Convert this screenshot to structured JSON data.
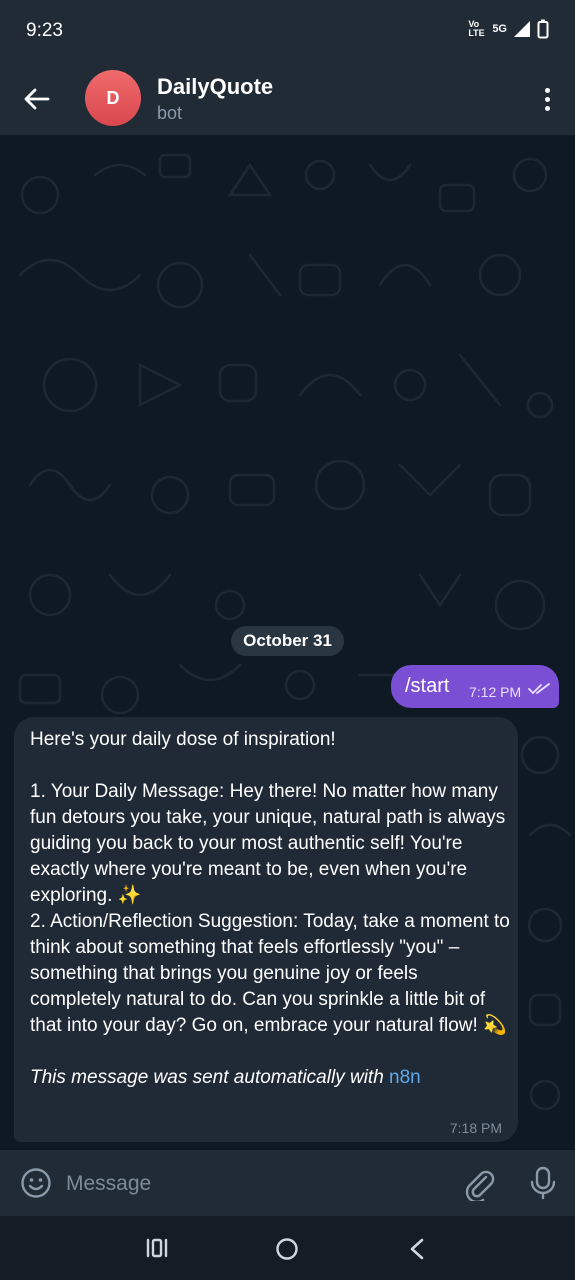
{
  "status_bar": {
    "time": "9:23",
    "network_label": "Vo LTE",
    "network_type": "5G",
    "icons": [
      "signal-icon",
      "battery-icon"
    ]
  },
  "header": {
    "avatar_letter": "D",
    "title": "DailyQuote",
    "subtitle": "bot",
    "avatar_color": "#e25a5f",
    "icons": [
      "back-arrow-icon",
      "more-vertical-icon"
    ]
  },
  "chat": {
    "date_label": "October 31",
    "outgoing": {
      "text": "/start",
      "time": "7:12 PM",
      "status": "read",
      "color": "#7b4fd4"
    },
    "incoming": {
      "intro": "Here's your daily dose of inspiration!",
      "item1": "1.  Your Daily Message: Hey there! No matter how many fun detours you take, your unique, natural path is always guiding you back to your most authentic self! You're exactly where you're meant to be, even when you're exploring. ✨",
      "item2": "2.  Action/Reflection Suggestion: Today, take a moment to think about something that feels effortlessly \"you\" – something that brings you genuine joy or feels completely natural to do. Can you sprinkle a little bit of that into your day? Go on, embrace your natural flow! 💫",
      "footer_prefix": "This message was sent automatically with ",
      "footer_link": "n8n",
      "time": "7:18 PM"
    }
  },
  "input": {
    "placeholder": "Message",
    "icons": [
      "emoji-icon",
      "paperclip-icon",
      "microphone-icon"
    ]
  },
  "nav": {
    "icons": [
      "recent-apps-icon",
      "home-icon",
      "back-icon"
    ]
  }
}
